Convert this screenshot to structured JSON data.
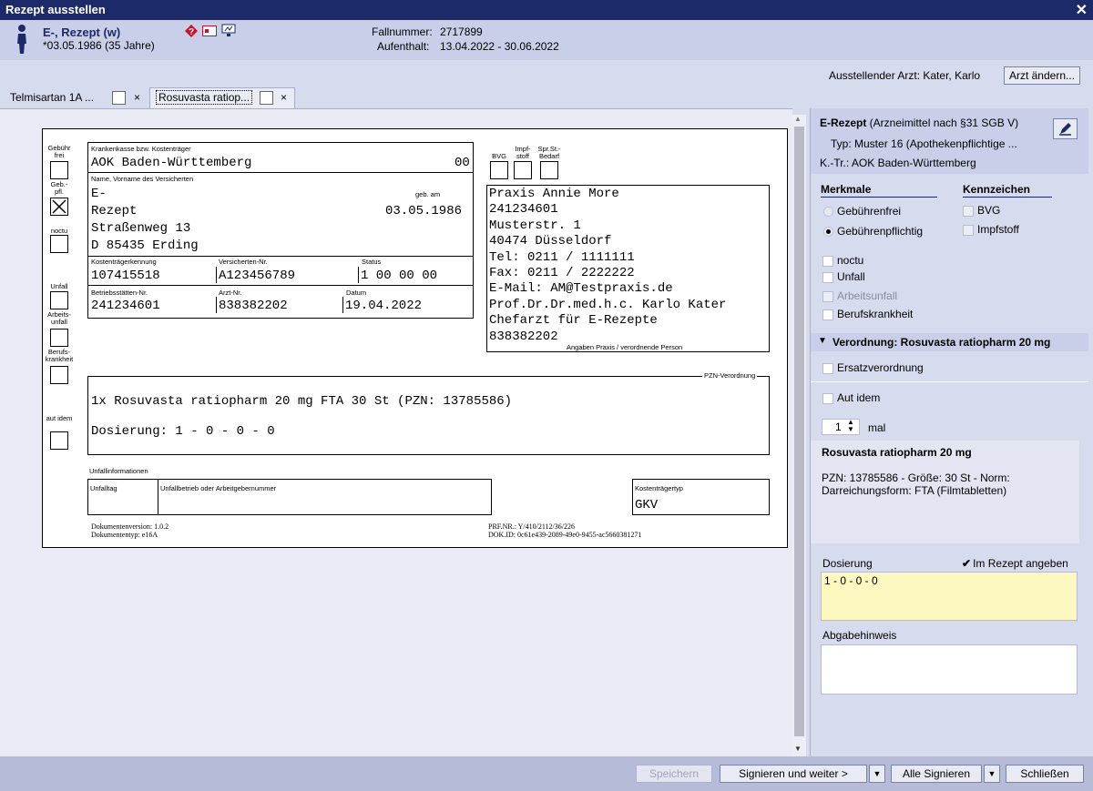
{
  "window": {
    "title": "Rezept ausstellen",
    "close": "✕"
  },
  "patient": {
    "name": "E-, Rezept  (w)",
    "dob": "*03.05.1986 (35 Jahre)",
    "case_label": "Fallnummer:",
    "case_value": "2717899",
    "stay_label": "Aufenthalt:",
    "stay_value": "13.04.2022 - 30.06.2022"
  },
  "doctor": {
    "label": "Ausstellender Arzt: Kater, Karlo",
    "change_button": "Arzt ändern..."
  },
  "tabs": [
    {
      "label": "Telmisartan 1A ...",
      "close": "×"
    },
    {
      "label": "Rosuvasta ratiop...",
      "close": "×"
    }
  ],
  "form": {
    "gebuehr_frei": "Gebühr frei",
    "geb_pfl": "Geb.- pfl.",
    "noctu": "noctu",
    "unfall": "Unfall",
    "arbeitsunfall": "Arbeits- unfall",
    "berufskrankheit": "Berufs- krankheit",
    "aut_idem": "aut idem",
    "kasse_label": "Krankenkasse bzw. Kostenträger",
    "kasse_value": "AOK Baden-Württemberg",
    "kasse_code": "00",
    "name_label": "Name, Vorname des Versicherten",
    "geb_label": "geb. am",
    "name_line1": "E-",
    "name_line2": "Rezept",
    "geb_value": "03.05.1986",
    "street": "Straßenweg 13",
    "city": "D 85435 Erding",
    "kt_kennung_label": "Kostenträgerkennung",
    "kt_kennung": "107415518",
    "vers_nr_label": "Versicherten-Nr.",
    "vers_nr": "A123456789",
    "status_label": "Status",
    "status": "1 00 00 00",
    "bsnr_label": "Betriebsstätten-Nr.",
    "bsnr": "241234601",
    "arzt_nr_label": "Arzt-Nr.",
    "arzt_nr": "838382202",
    "datum_label": "Datum",
    "datum": "19.04.2022",
    "bvg": "BVG",
    "impfstoff": "Impf- stoff",
    "spr_bedarf": "Spr.St.- Bedarf",
    "praxis_lines": [
      "Praxis Annie More",
      "241234601",
      "Musterstr.  1",
      "40474 Düsseldorf",
      "Tel: 0211 / 1111111",
      "Fax: 0211 / 2222222",
      "E-Mail: AM@Testpraxis.de",
      "Prof.Dr.Dr.med.h.c. Karlo Kater",
      "Chefarzt für E-Rezepte",
      "838382202"
    ],
    "praxis_caption": "Angaben Praxis / verordnende Person",
    "pzn_caption": "PZN-Verordnung",
    "verordnung": "1x Rosuvasta ratiopharm 20 mg FTA 30 St (PZN: 13785586)",
    "dosierung": "Dosierung: 1 - 0 - 0 - 0",
    "unfallinfo": "Unfallinformationen",
    "unfalltag": "Unfalltag",
    "unfallbetrieb": "Unfallbetrieb oder Arbeitgebernummer",
    "kt_typ_label": "Kostenträgertyp",
    "kt_typ": "GKV",
    "dok_version": "Dokumentenversion: 1.0.2",
    "dok_typ": "Dokumententyp: e16A",
    "prf": "PRF.NR.: Y/410/2112/36/226",
    "dok_id": "DOK.ID: 0c61e439-2089-49e0-9455-ac5660381271"
  },
  "right": {
    "title_bold": "E-Rezept",
    "title_rest": " (Arzneimittel nach §31 SGB V)",
    "typ": "Typ:  Muster 16 (Apothekenpflichtige ...",
    "ktr": "K.-Tr.:  AOK Baden-Württemberg",
    "merkmale": "Merkmale",
    "kennzeichen": "Kennzeichen",
    "gebuehrenfrei": "Gebührenfrei",
    "gebuehrenpflichtig": "Gebührenpflichtig",
    "bvg": "BVG",
    "impfstoff": "Impfstoff",
    "noctu": "noctu",
    "unfall": "Unfall",
    "arbeitsunfall": "Arbeitsunfall",
    "berufskrankheit": "Berufskrankheit",
    "verordnung_header": "Verordnung: Rosuvasta ratiopharm 20 mg",
    "ersatz": "Ersatzverordnung",
    "aut_idem": "Aut idem",
    "mal_value": "1",
    "mal": "mal",
    "drug_name": "Rosuvasta ratiopharm 20 mg",
    "drug_info": "PZN: 13785586 - Größe: 30 St - Norm: Darreichungsform: FTA (Filmtabletten)",
    "dosierung_label": "Dosierung",
    "im_rezept": "Im Rezept angeben",
    "dosierung_value": "1 - 0 - 0 - 0",
    "abgabehinweis": "Abgabehinweis"
  },
  "footer": {
    "speichern": "Speichern",
    "signieren": "Signieren und weiter >",
    "alle": "Alle Signieren",
    "schliessen": "Schließen"
  }
}
